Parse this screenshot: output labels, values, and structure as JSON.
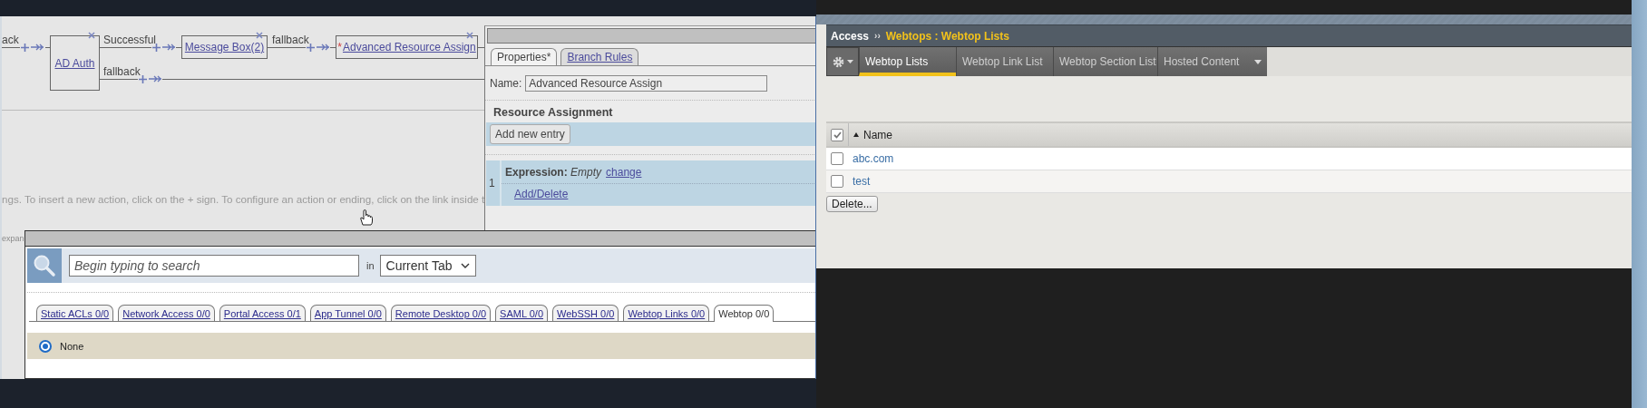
{
  "flow": {
    "cut_label": "ack",
    "nodes": [
      {
        "label": "AD Auth"
      },
      {
        "label": "Message Box(2)"
      },
      {
        "label": "Advanced Resource Assign",
        "marker": "*"
      }
    ],
    "branches": [
      {
        "label": "Successful"
      },
      {
        "label": "fallback"
      },
      {
        "label": "fallback"
      }
    ],
    "hint": "ngs. To insert a new action, click on the + sign. To configure an action or ending, click on the link inside t",
    "cut_hint": "expan"
  },
  "properties_panel": {
    "tabs": [
      {
        "label": "Properties*",
        "selected": true
      },
      {
        "label": "Branch Rules",
        "selected": false
      }
    ],
    "name_label": "Name:",
    "name_value": "Advanced Resource Assign",
    "section_title": "Resource Assignment",
    "add_button": "Add new entry",
    "entries": [
      {
        "index": "1",
        "expression_label": "Expression:",
        "expression_value": "Empty",
        "change_link": "change",
        "add_delete_link": "Add/Delete"
      }
    ]
  },
  "resource_dialog": {
    "search": {
      "placeholder": "Begin typing to search"
    },
    "scope_label": "in",
    "scope_value": "Current Tab",
    "tabs": [
      {
        "label": "Static ACLs 0/0",
        "selected": false
      },
      {
        "label": "Network Access 0/0",
        "selected": false
      },
      {
        "label": "Portal Access 0/1",
        "selected": false
      },
      {
        "label": "App Tunnel 0/0",
        "selected": false
      },
      {
        "label": "Remote Desktop 0/0",
        "selected": false
      },
      {
        "label": "SAML 0/0",
        "selected": false
      },
      {
        "label": "WebSSH 0/0",
        "selected": false
      },
      {
        "label": "Webtop Links 0/0",
        "selected": false
      },
      {
        "label": "Webtop 0/0",
        "selected": true
      }
    ],
    "options": [
      {
        "label": "None",
        "selected": true
      }
    ]
  },
  "webtop_app": {
    "breadcrumb": {
      "root": "Access",
      "separator": "››",
      "path": "Webtops : Webtop Lists"
    },
    "tabs": [
      {
        "label": "Webtop Lists",
        "selected": true,
        "has_menu": false
      },
      {
        "label": "Webtop Link List",
        "selected": false,
        "has_menu": false
      },
      {
        "label": "Webtop Section List",
        "selected": false,
        "has_menu": false
      },
      {
        "label": "Hosted Content",
        "selected": false,
        "has_menu": true
      }
    ],
    "table": {
      "select_all_checked": true,
      "columns": [
        {
          "label": "Name",
          "sort_ascending": true
        }
      ],
      "rows": [
        {
          "name": "abc.com",
          "checked": false
        },
        {
          "name": "test",
          "checked": false
        }
      ]
    },
    "delete_button": "Delete..."
  }
}
